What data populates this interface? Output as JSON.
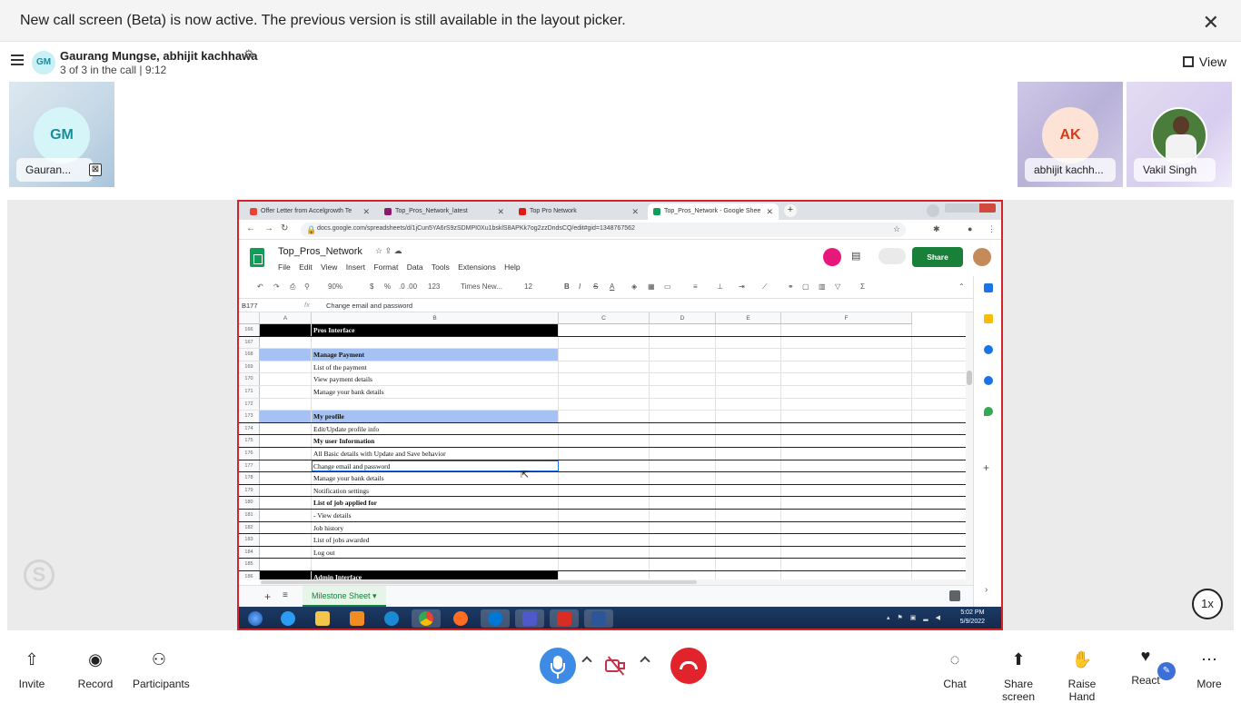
{
  "banner": {
    "text": "New call screen (Beta) is now active. The previous version is still available in the layout picker.",
    "close_icon": "✕"
  },
  "header": {
    "avatar_initials": "GM",
    "title": "Gaurang Mungse, abhijit kachhawa",
    "subtitle": "3 of 3 in the call | 9:12",
    "view_label": "View"
  },
  "participants": [
    {
      "initials": "GM",
      "name": "Gauran...",
      "muted_icon": "⊠"
    },
    {
      "initials": "AK",
      "name": "abhijit kachh..."
    },
    {
      "name": "Vakil Singh"
    }
  ],
  "shared_screen": {
    "tabs": [
      {
        "label": "Offer Letter from Accelgrowth Te"
      },
      {
        "label": "Top_Pros_Network_latest"
      },
      {
        "label": "Top Pro Network"
      },
      {
        "label": "Top_Pros_Network - Google Shee"
      }
    ],
    "url": "docs.google.com/spreadsheets/d/1jCun5YA6rS9zSDMPI0Xu1bsklS8APKk7og2zzDndsCQ/edit#gid=1348767562",
    "doc_title": "Top_Pros_Network",
    "menus": [
      "File",
      "Edit",
      "View",
      "Insert",
      "Format",
      "Data",
      "Tools",
      "Extensions",
      "Help"
    ],
    "share_label": "Share",
    "toolbar": {
      "zoom": "90%",
      "currency": "$",
      "percent": "%",
      "decimals": ".0 .00",
      "format": "123",
      "font": "Times New...",
      "font_size": "12"
    },
    "name_box": "B177",
    "formula": "Change email and password",
    "columns": [
      "A",
      "B",
      "C",
      "D",
      "E",
      "F"
    ],
    "rows": [
      {
        "num": "166",
        "text": "Pros Interface"
      },
      {
        "num": "167",
        "text": ""
      },
      {
        "num": "168",
        "text": "Manage Payment"
      },
      {
        "num": "169",
        "text": "List of the payment"
      },
      {
        "num": "170",
        "text": "View payment details"
      },
      {
        "num": "171",
        "text": "Manage your bank details"
      },
      {
        "num": "172",
        "text": ""
      },
      {
        "num": "173",
        "text": "My profile"
      },
      {
        "num": "174",
        "text": "Edit/Update profile info"
      },
      {
        "num": "175",
        "text": "My user Information"
      },
      {
        "num": "176",
        "text": "All Basic details with Update and Save behavior"
      },
      {
        "num": "177",
        "text": "Change email and password"
      },
      {
        "num": "178",
        "text": "Manage your bank details"
      },
      {
        "num": "179",
        "text": "Notification settings"
      },
      {
        "num": "180",
        "text": "List of job applied for"
      },
      {
        "num": "181",
        "text": "- View details"
      },
      {
        "num": "182",
        "text": "Job history"
      },
      {
        "num": "183",
        "text": "List of jobs awarded"
      },
      {
        "num": "184",
        "text": "Log out"
      },
      {
        "num": "185",
        "text": ""
      },
      {
        "num": "186",
        "text": "Admin Interface"
      }
    ],
    "sheet_tab": "Milestone Sheet",
    "clock_time": "5:02 PM",
    "clock_date": "5/9/2022"
  },
  "speed_label": "1x",
  "controls": {
    "invite": "Invite",
    "record": "Record",
    "participants": "Participants",
    "chat": "Chat",
    "share_screen": "Share screen",
    "raise_hand": "Raise Hand",
    "react": "React",
    "more": "More"
  }
}
